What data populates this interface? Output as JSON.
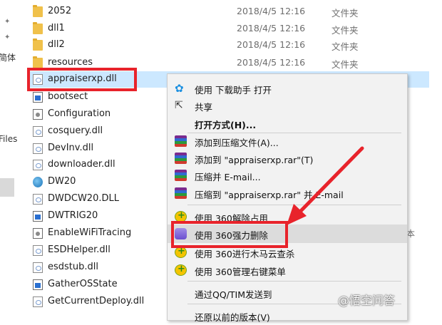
{
  "left_pane": {
    "labels": [
      "简体",
      "Files"
    ]
  },
  "files": [
    {
      "name": "2052",
      "date": "2018/4/5 12:16",
      "type": "文件夹",
      "icon": "folder-icon"
    },
    {
      "name": "dll1",
      "date": "2018/4/5 12:16",
      "type": "文件夹",
      "icon": "folder-icon"
    },
    {
      "name": "dll2",
      "date": "2018/4/5 12:16",
      "type": "文件夹",
      "icon": "folder-icon"
    },
    {
      "name": "resources",
      "date": "2018/4/5 12:16",
      "type": "文件夹",
      "icon": "folder-icon"
    },
    {
      "name": "appraiserxp.dll",
      "date": "",
      "type": "",
      "icon": "dll-file-icon",
      "selected": true
    },
    {
      "name": "bootsect",
      "date": "",
      "type": "",
      "icon": "app-icon"
    },
    {
      "name": "Configuration",
      "date": "",
      "type": "",
      "icon": "config-icon"
    },
    {
      "name": "cosquery.dll",
      "date": "",
      "type": "",
      "icon": "dll-file-icon"
    },
    {
      "name": "DevInv.dll",
      "date": "",
      "type": "",
      "icon": "dll-file-icon"
    },
    {
      "name": "downloader.dll",
      "date": "",
      "type": "",
      "icon": "dll-file-icon"
    },
    {
      "name": "DW20",
      "date": "",
      "type": "",
      "icon": "globe-app-icon"
    },
    {
      "name": "DWDCW20.DLL",
      "date": "",
      "type": "",
      "icon": "dll-file-icon"
    },
    {
      "name": "DWTRIG20",
      "date": "",
      "type": "",
      "icon": "app-icon"
    },
    {
      "name": "EnableWiFiTracing",
      "date": "",
      "type": "",
      "icon": "config-icon"
    },
    {
      "name": "ESDHelper.dll",
      "date": "",
      "type": "",
      "icon": "dll-file-icon"
    },
    {
      "name": "esdstub.dll",
      "date": "",
      "type": "",
      "icon": "dll-file-icon"
    },
    {
      "name": "GatherOSState",
      "date": "",
      "type": "",
      "icon": "app-icon"
    },
    {
      "name": "GetCurrentDeploy.dll",
      "date": "",
      "type": "",
      "icon": "dll-file-icon"
    }
  ],
  "beyond_menu_text": "本",
  "context_menu": {
    "items": [
      {
        "label": "使用 下载助手 打开",
        "icon": "paw-icon"
      },
      {
        "label": "共享",
        "icon": "share-icon"
      },
      {
        "label": "打开方式(H)...",
        "icon": "",
        "bold": true
      },
      {
        "label": "添加到压缩文件(A)...",
        "icon": "winrar-icon"
      },
      {
        "label": "添加到 \"appraiserxp.rar\"(T)",
        "icon": "winrar-icon"
      },
      {
        "label": "压缩并 E-mail...",
        "icon": "winrar-icon"
      },
      {
        "label": "压缩到 \"appraiserxp.rar\" 并 E-mail",
        "icon": "winrar-icon"
      },
      {
        "label": "使用 360解除占用",
        "icon": "360-icon"
      },
      {
        "label": "使用 360强力删除",
        "icon": "360-shred-icon",
        "hover": true
      },
      {
        "label": "使用 360进行木马云查杀",
        "icon": "360-icon"
      },
      {
        "label": "使用 360管理右键菜单",
        "icon": "360-icon"
      },
      {
        "label": "通过QQ/TIM发送到",
        "icon": ""
      },
      {
        "label": "还原以前的版本(V)",
        "icon": ""
      }
    ]
  },
  "watermark": "@悟空问答"
}
